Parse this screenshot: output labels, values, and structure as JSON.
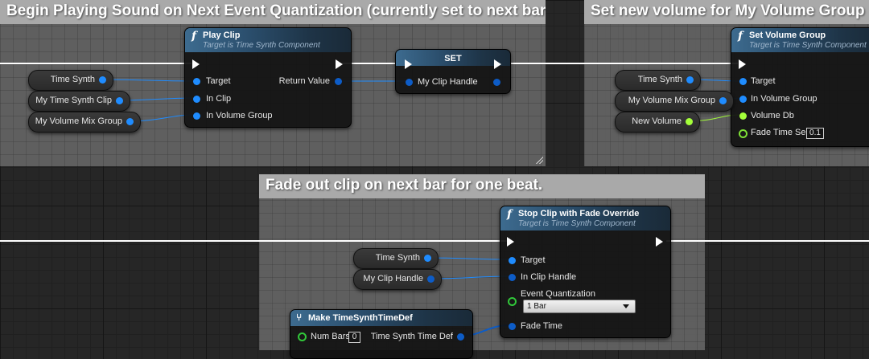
{
  "comments": {
    "c1": {
      "title": "Begin Playing Sound on Next Event Quantization (currently set to next bar)"
    },
    "c2": {
      "title": "Set new volume for My Volume Group"
    },
    "c3": {
      "title": "Fade out clip on next bar for one beat."
    }
  },
  "play_clip": {
    "title": "Play Clip",
    "subtitle": "Target is Time Synth Component",
    "inputs": [
      "Target",
      "In Clip",
      "In Volume Group"
    ],
    "output": "Return Value"
  },
  "set_node": {
    "title": "SET",
    "input": "My Clip Handle"
  },
  "set_volume_group": {
    "title": "Set Volume Group",
    "subtitle": "Target is Time Synth Component",
    "inputs": [
      "Target",
      "In Volume Group",
      "Volume Db",
      "Fade Time Sec"
    ],
    "fade_time_value": "0.1"
  },
  "stop_clip": {
    "title": "Stop Clip with Fade Override",
    "subtitle": "Target is Time Synth Component",
    "inputs": [
      "Target",
      "In Clip Handle",
      "Event Quantization",
      "Fade Time"
    ],
    "quantization_value": "1 Bar"
  },
  "make_def": {
    "title": "Make TimeSynthTimeDef",
    "input": "Num Bars",
    "num_bars_value": "0",
    "output": "Time Synth Time Def"
  },
  "variables": {
    "v1": "Time Synth",
    "v2": "My Time Synth Clip",
    "v3": "My Volume Mix Group",
    "v4": "Time Synth",
    "v5": "My Volume Mix Group",
    "v6": "New Volume",
    "v7": "Time Synth",
    "v8": "My Clip Handle"
  },
  "colors": {
    "object_pin": "#1f8cff",
    "struct_pin": "#0d5cc7",
    "float_pin": "#a4ff3a",
    "enum_pin": "#31c83a",
    "exec_pin": "#ffffff",
    "comment_header": "#a9a9a9"
  }
}
